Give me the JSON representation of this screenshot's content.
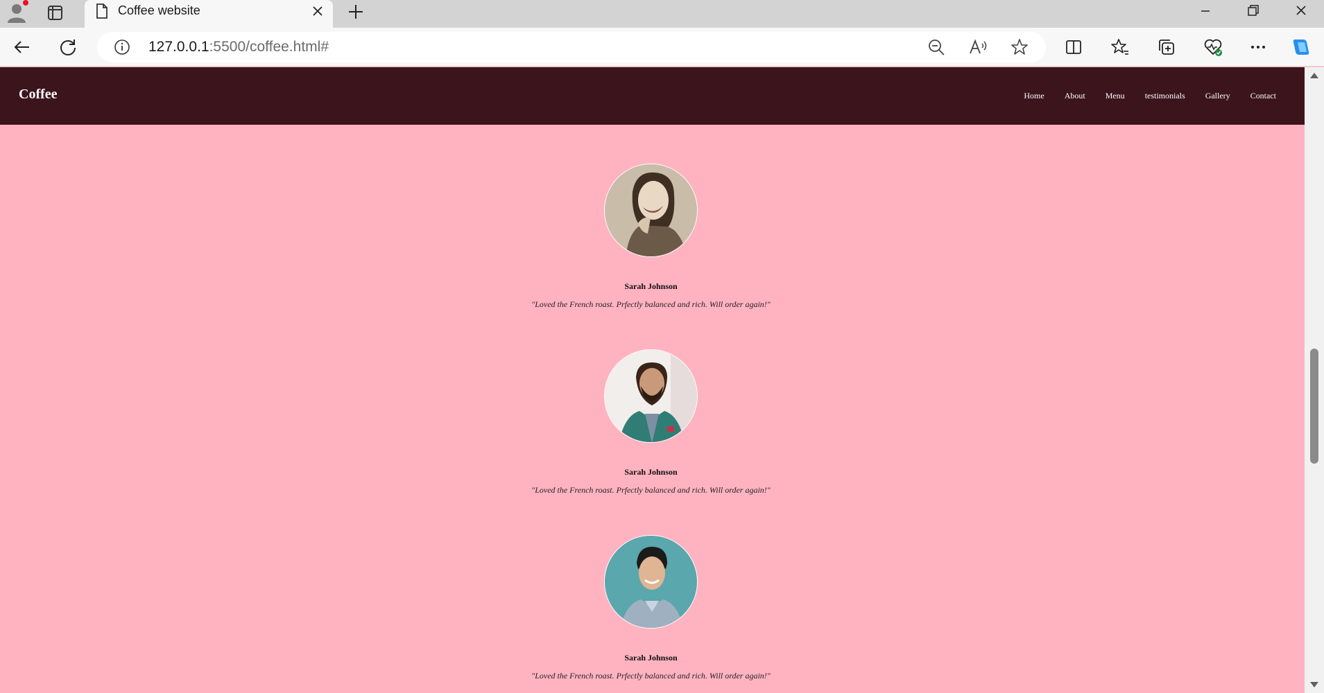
{
  "browser": {
    "tab_title": "Coffee website",
    "url_host": "127.0.0.1",
    "url_rest": ":5500/coffee.html#"
  },
  "site": {
    "brand": "Coffee",
    "nav": [
      "Home",
      "About",
      "Menu",
      "testimonials",
      "Gallery",
      "Contact"
    ]
  },
  "testimonials": [
    {
      "name": "Sarah Johnson",
      "quote": "\"Loved the French roast. Prfectly balanced and rich. Will order again!\""
    },
    {
      "name": "Sarah Johnson",
      "quote": "\"Loved the French roast. Prfectly balanced and rich. Will order again!\""
    },
    {
      "name": "Sarah Johnson",
      "quote": "\"Loved the French roast. Prfectly balanced and rich. Will order again!\""
    }
  ],
  "colors": {
    "navbar": "#3c141c",
    "page_bg": "#ffb3c1",
    "profile_notification": "#e81123"
  },
  "icons": {
    "profile": "profile-icon",
    "tab_actions": "tab-actions-icon",
    "tab_page": "page-icon",
    "close": "close-icon",
    "new_tab": "plus-icon",
    "back": "back-arrow-icon",
    "refresh": "refresh-icon",
    "info": "info-icon",
    "zoom": "zoom-out-icon",
    "read_aloud": "read-aloud-icon",
    "favorite": "star-icon"
  }
}
